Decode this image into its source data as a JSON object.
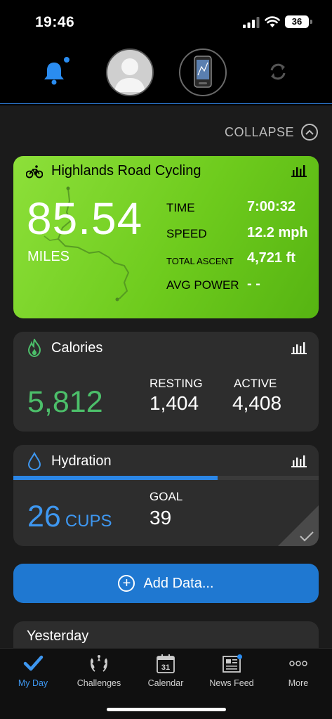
{
  "status_bar": {
    "time": "19:46",
    "battery": "36"
  },
  "header": {
    "icons": [
      "bell-icon",
      "avatar",
      "device-icon",
      "sync-icon"
    ],
    "accent": "#2e7bd6"
  },
  "collapse": {
    "label": "COLLAPSE"
  },
  "activity": {
    "title": "Highlands Road Cycling",
    "distance": "85.54",
    "distance_unit": "MILES",
    "stats": [
      {
        "label": "TIME",
        "value": "7:00:32"
      },
      {
        "label": "SPEED",
        "value": "12.2 mph"
      },
      {
        "label": "TOTAL ASCENT",
        "value": "4,721 ft"
      },
      {
        "label": "AVG POWER",
        "value": "- -"
      }
    ],
    "color": "#6ecb1d"
  },
  "calories": {
    "title": "Calories",
    "total": "5,812",
    "resting_label": "RESTING",
    "resting_value": "1,404",
    "active_label": "ACTIVE",
    "active_value": "4,408",
    "color": "#4cbf6a"
  },
  "hydration": {
    "title": "Hydration",
    "cups": "26",
    "cups_unit": "CUPS",
    "goal_label": "GOAL",
    "goal_value": "39",
    "progress": 0.67,
    "color": "#3e97f0"
  },
  "add_data": {
    "label": "Add Data..."
  },
  "yesterday": {
    "label": "Yesterday"
  },
  "tabs": [
    {
      "label": "My Day",
      "icon": "checkmark-icon",
      "active": true
    },
    {
      "label": "Challenges",
      "icon": "laurel-icon",
      "active": false
    },
    {
      "label": "Calendar",
      "icon": "calendar-icon",
      "active": false,
      "day": "31"
    },
    {
      "label": "News Feed",
      "icon": "newspaper-icon",
      "active": false
    },
    {
      "label": "More",
      "icon": "more-icon",
      "active": false
    }
  ]
}
